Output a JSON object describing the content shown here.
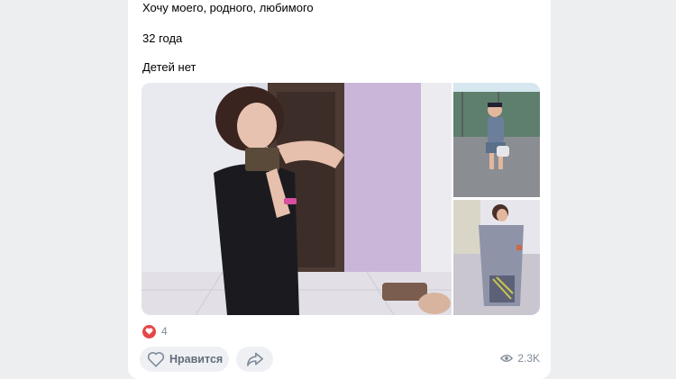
{
  "post": {
    "text_lines": [
      "Хочу моего, родного, любимого",
      "32 года",
      "Детей нет"
    ],
    "likes_count": "4",
    "views_count": "2.3K"
  },
  "actions": {
    "like_label": "Нравится"
  },
  "icons": {
    "heart_badge": "heart-icon",
    "like": "heart-outline-icon",
    "share": "share-arrow-icon",
    "views": "eye-icon"
  },
  "colors": {
    "background": "#edeef0",
    "card": "#ffffff",
    "like_red": "#e64646",
    "muted_text": "#818c99",
    "button_bg": "#eef0f3"
  }
}
